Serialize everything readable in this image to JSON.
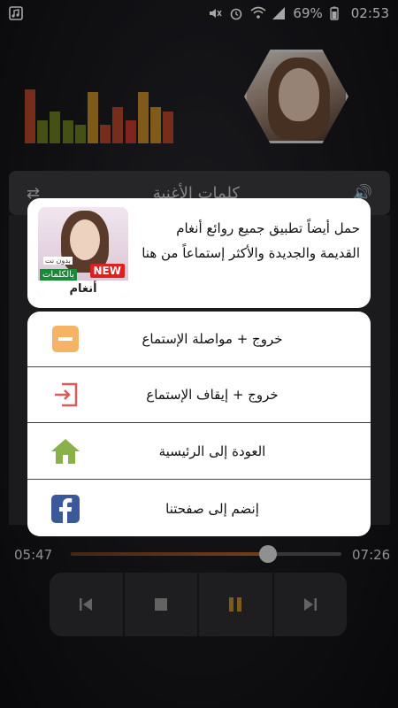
{
  "status_bar": {
    "battery": "69%",
    "time": "02:53"
  },
  "background": {
    "lyrics_tab": "كلمات الأغنية"
  },
  "player": {
    "elapsed": "05:47",
    "duration": "07:26",
    "progress": 0.73,
    "controls": [
      "previous-icon",
      "stop-icon",
      "pause-icon",
      "next-icon"
    ],
    "accent_color": "#c58a2a"
  },
  "equalizer": {
    "levels": [
      0.92,
      0.4,
      0.55,
      0.4,
      0.32,
      0.88,
      0.32,
      0.62,
      0.4,
      0.88,
      0.62,
      0.55
    ],
    "colors": [
      "#b5452a",
      "#6a7d1f",
      "#6a7d1f",
      "#6a7d1f",
      "#6a7d1f",
      "#c58a2a",
      "#b5452a",
      "#b5452a",
      "#c53a2a",
      "#c58a2a",
      "#c58a2a",
      "#b5452a"
    ]
  },
  "promo": {
    "text": "حمل أيضاً تطبيق جميع روائع أنغام القديمة والجديدة والأكثر إستماعاً من هنا",
    "app_name": "أنغام",
    "badge_new": "NEW",
    "badge_words": "بالكلمات",
    "badge_nonet": "بدون نت"
  },
  "menu": {
    "items": [
      {
        "label": "خروج + مواصلة الإستماع",
        "icon": "minus-icon"
      },
      {
        "label": "خروج + إيقاف الإستماع",
        "icon": "exit-icon"
      },
      {
        "label": "العودة إلى الرئيسية",
        "icon": "home-icon"
      },
      {
        "label": "إنضم إلى صفحتنا",
        "icon": "facebook-icon"
      }
    ]
  }
}
